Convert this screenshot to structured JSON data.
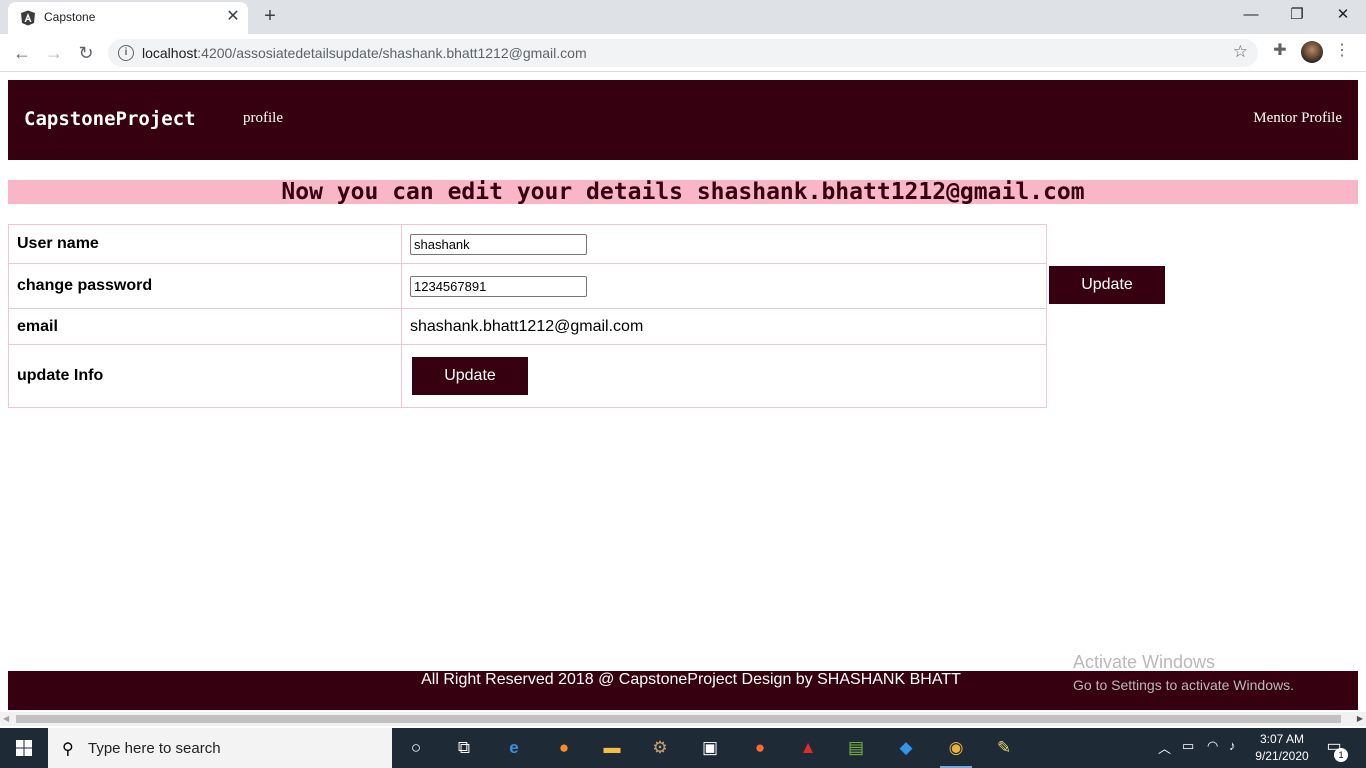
{
  "browser": {
    "tab_title": "Capstone",
    "new_tab": "+",
    "url_host": "localhost",
    "url_rest": ":4200/assosiatedetailsupdate/shashank.bhatt1212@gmail.com"
  },
  "navbar": {
    "brand": "CapstoneProject",
    "profile_link": "profile",
    "mentor_link": "Mentor Profile"
  },
  "heading": "Now you can edit your details shashank.bhatt1212@gmail.com",
  "form": {
    "username_label": "User name",
    "username_value": "shashank",
    "password_label": "change password",
    "password_value": "1234567891",
    "email_label": "email",
    "email_value": "shashank.bhatt1212@gmail.com",
    "update_info_label": "update Info",
    "update_button": "Update",
    "update_button_side": "Update"
  },
  "footer": {
    "text": "All Right Reserved 2018 @ CapstoneProject Design by SHASHANK BHATT"
  },
  "watermark": {
    "line1": "Activate Windows",
    "line2": "Go to Settings to activate Windows."
  },
  "taskbar": {
    "search_placeholder": "Type here to search",
    "time": "3:07 AM",
    "date": "9/21/2020",
    "notification_count": "1"
  },
  "colors": {
    "brand_dark": "#360011",
    "heading_bg": "#f8b6c6"
  }
}
